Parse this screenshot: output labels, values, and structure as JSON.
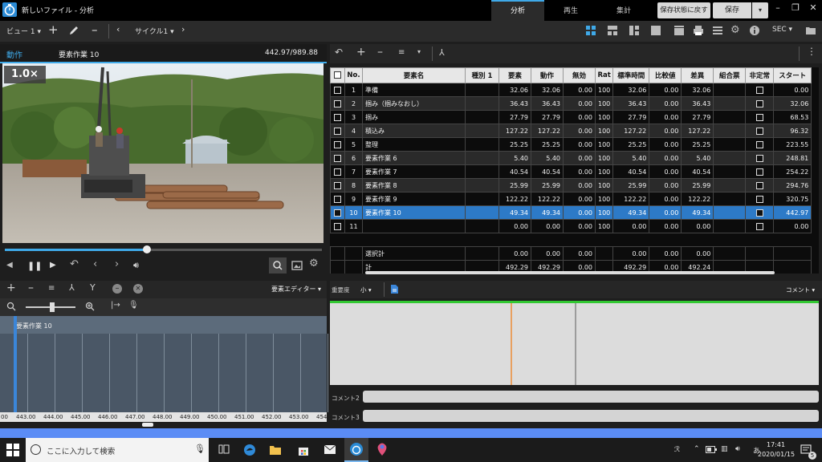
{
  "window": {
    "title": "新しいファイル - 分析"
  },
  "main_tabs": [
    "分析",
    "再生",
    "集計"
  ],
  "header_buttons": {
    "save_state": "保存状態に戻す",
    "save": "保存"
  },
  "toolbar": {
    "view": "ビュー 1",
    "cycle": "サイクル1",
    "unit": "SEC"
  },
  "video": {
    "mode": "動作",
    "element": "要素作業 10",
    "time": "442.97/989.88",
    "speed": "1.0×",
    "progress": 0.447
  },
  "timeline": {
    "editor": "要素エディター",
    "element_label": "要素作業 10",
    "zoom_level": 0.45,
    "ticks": [
      "443.00",
      "444.00",
      "445.00",
      "446.00",
      "447.00",
      "448.00",
      "449.00",
      "450.00",
      "451.00",
      "452.00",
      "453.00",
      "454.0"
    ],
    "tick_prefix": "00"
  },
  "table": {
    "headers": [
      "",
      "No.",
      "要素名",
      "種別 1",
      "要素",
      "動作",
      "無効",
      "Rat",
      "標準時間",
      "比較値",
      "差異",
      "組合票",
      "非定常",
      "スタート"
    ],
    "rows": [
      {
        "no": "1",
        "name": "準備",
        "type": "",
        "elem": "32.06",
        "act": "32.06",
        "inv": "0.00",
        "rat": "100",
        "std": "32.06",
        "cmp": "0.00",
        "diff": "32.06",
        "start": "0.00"
      },
      {
        "no": "2",
        "name": "掴み（掴みなおし）",
        "type": "",
        "elem": "36.43",
        "act": "36.43",
        "inv": "0.00",
        "rat": "100",
        "std": "36.43",
        "cmp": "0.00",
        "diff": "36.43",
        "start": "32.06"
      },
      {
        "no": "3",
        "name": "掴み",
        "type": "",
        "elem": "27.79",
        "act": "27.79",
        "inv": "0.00",
        "rat": "100",
        "std": "27.79",
        "cmp": "0.00",
        "diff": "27.79",
        "start": "68.53"
      },
      {
        "no": "4",
        "name": "積込み",
        "type": "",
        "elem": "127.22",
        "act": "127.22",
        "inv": "0.00",
        "rat": "100",
        "std": "127.22",
        "cmp": "0.00",
        "diff": "127.22",
        "start": "96.32"
      },
      {
        "no": "5",
        "name": "整理",
        "type": "",
        "elem": "25.25",
        "act": "25.25",
        "inv": "0.00",
        "rat": "100",
        "std": "25.25",
        "cmp": "0.00",
        "diff": "25.25",
        "start": "223.55"
      },
      {
        "no": "6",
        "name": "要素作業 6",
        "type": "",
        "elem": "5.40",
        "act": "5.40",
        "inv": "0.00",
        "rat": "100",
        "std": "5.40",
        "cmp": "0.00",
        "diff": "5.40",
        "start": "248.81"
      },
      {
        "no": "7",
        "name": "要素作業 7",
        "type": "",
        "elem": "40.54",
        "act": "40.54",
        "inv": "0.00",
        "rat": "100",
        "std": "40.54",
        "cmp": "0.00",
        "diff": "40.54",
        "start": "254.22"
      },
      {
        "no": "8",
        "name": "要素作業 8",
        "type": "",
        "elem": "25.99",
        "act": "25.99",
        "inv": "0.00",
        "rat": "100",
        "std": "25.99",
        "cmp": "0.00",
        "diff": "25.99",
        "start": "294.76"
      },
      {
        "no": "9",
        "name": "要素作業 9",
        "type": "",
        "elem": "122.22",
        "act": "122.22",
        "inv": "0.00",
        "rat": "100",
        "std": "122.22",
        "cmp": "0.00",
        "diff": "122.22",
        "start": "320.75"
      },
      {
        "no": "10",
        "name": "要素作業 10",
        "type": "",
        "elem": "49.34",
        "act": "49.34",
        "inv": "0.00",
        "rat": "100",
        "std": "49.34",
        "cmp": "0.00",
        "diff": "49.34",
        "start": "442.97"
      },
      {
        "no": "11",
        "name": "",
        "type": "",
        "elem": "0.00",
        "act": "0.00",
        "inv": "0.00",
        "rat": "100",
        "std": "0.00",
        "cmp": "0.00",
        "diff": "0.00",
        "start": "0.00"
      }
    ],
    "selected_total": {
      "label": "選択計",
      "elem": "0.00",
      "act": "0.00",
      "inv": "0.00",
      "std": "0.00",
      "cmp": "0.00",
      "diff": "0.00"
    },
    "total": {
      "label": "計",
      "elem": "492.29",
      "act": "492.29",
      "inv": "0.00",
      "std": "492.29",
      "cmp": "0.00",
      "diff": "492.24"
    }
  },
  "comments": {
    "importance_label": "重要度",
    "importance_value": "小",
    "comment_label": "コメント",
    "comment2": "コメント2",
    "comment3": "コメント3"
  },
  "taskbar": {
    "search_placeholder": "ここに入力して検索",
    "time": "17:41",
    "date": "2020/01/15",
    "notifications": "5"
  },
  "colors": {
    "accent": "#3fa9e8",
    "selected_row": "#2d7ac7",
    "comment_green": "#32c832",
    "status_bar": "#5b8cf5"
  }
}
